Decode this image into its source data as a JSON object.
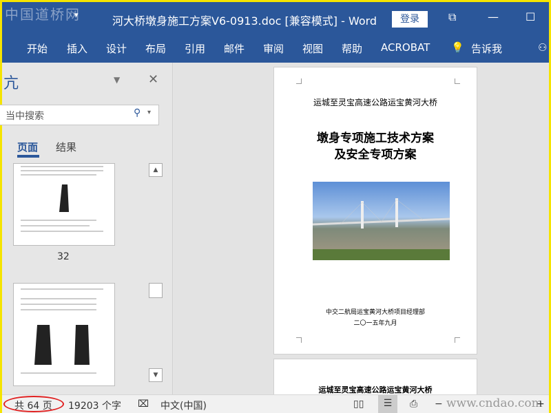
{
  "watermark": "中国道桥网",
  "title": "河大桥墩身施工方案V6-0913.doc [兼容模式]  -  Word",
  "login": "登录",
  "ribbon": [
    "开始",
    "插入",
    "设计",
    "布局",
    "引用",
    "邮件",
    "审阅",
    "视图",
    "帮助",
    "ACROBAT",
    "告诉我"
  ],
  "nav": {
    "title": "亢",
    "search_placeholder": "当中搜索",
    "tabs": [
      "页面",
      "结果"
    ],
    "thumb_page": "32"
  },
  "page1": {
    "header": "运城至灵宝高速公路运宝黄河大桥",
    "title1": "墩身专项施工技术方案",
    "title2": "及安全专项方案",
    "org": "中交二航局运宝黄河大桥项目经理部",
    "date": "二〇一五年九月"
  },
  "page2": {
    "header": "运城至灵宝高速公路运宝黄河大桥"
  },
  "status": {
    "pages": "共 64 页",
    "words": "19203 个字",
    "language": "中文(中国)",
    "site": "www.cndao.com"
  }
}
